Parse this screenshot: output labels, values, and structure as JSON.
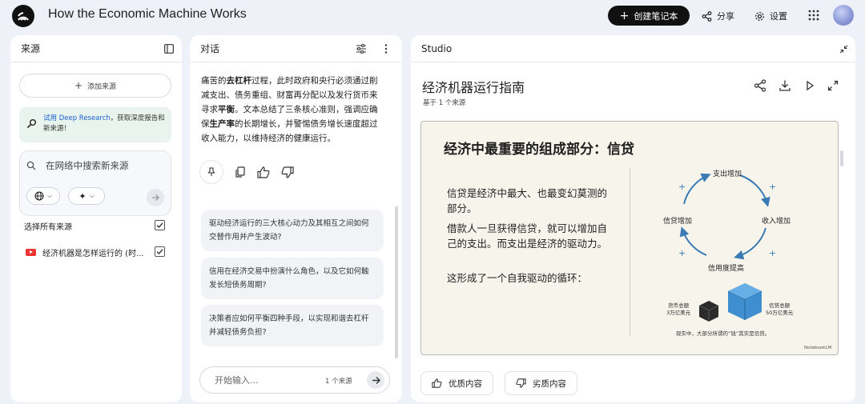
{
  "app": {
    "title": "How the Economic Machine Works",
    "create_label": "创建笔记本",
    "share_label": "分享",
    "settings_label": "设置"
  },
  "sources": {
    "title": "来源",
    "add_label": "添加来源",
    "banner": {
      "link": "试用 Deep Research",
      "text": "，获取深度报告和新来源！"
    },
    "search_placeholder": "在网络中搜索新来源",
    "select_all_label": "选择所有来源",
    "items": [
      {
        "name": "经济机器是怎样运行的 (时...",
        "checked": true
      }
    ]
  },
  "chat": {
    "title": "对话",
    "message_parts": [
      "痛苦的",
      "去杠杆",
      "过程，此时政府和央行必须通过削减支出、债务重组、财富再分配以及发行货币来寻求",
      "平衡",
      "。文本总结了三条核心准则，强调应确保",
      "生产率",
      "的长期增长，并警惕债务增长速度超过收入能力，以维持经济的健康运行。"
    ],
    "suggestions": [
      "驱动经济运行的三大核心动力及其相互之间如何交替作用并产生波动?",
      "信用在经济交易中扮演什么角色，以及它如何触发长短债务周期?",
      "决策者应如何平衡四种手段，以实现和谐去杠杆并减轻债务负担?"
    ],
    "input_placeholder": "开始输入...",
    "source_count": "1 个来源"
  },
  "studio": {
    "title": "Studio",
    "guide_title": "经济机器运行指南",
    "guide_subtitle": "基于 1 个来源",
    "slide": {
      "title": "经济中最重要的组成部分：信贷",
      "paragraphs": [
        "信贷是经济中最大、也最变幻莫测的部分。",
        "借款人一旦获得信贷，就可以增加自己的支出。而支出是经济的驱动力。",
        "这形成了一个自我驱动的循环："
      ],
      "cycle": [
        "支出增加",
        "收入增加",
        "信用度提高",
        "信贷增加"
      ],
      "money_label": [
        "货币总额",
        "3万亿美元"
      ],
      "credit_label": [
        "信贷总额",
        "50万亿美元"
      ],
      "footnote": "现实中，大部分所谓的“钱”其实是信贷。",
      "brand": "NotebookLM"
    },
    "good_label": "优质内容",
    "bad_label": "劣质内容"
  },
  "colors": {
    "accent": "#3a7ab5",
    "dark": "#111111",
    "background": "#eef1f8"
  }
}
